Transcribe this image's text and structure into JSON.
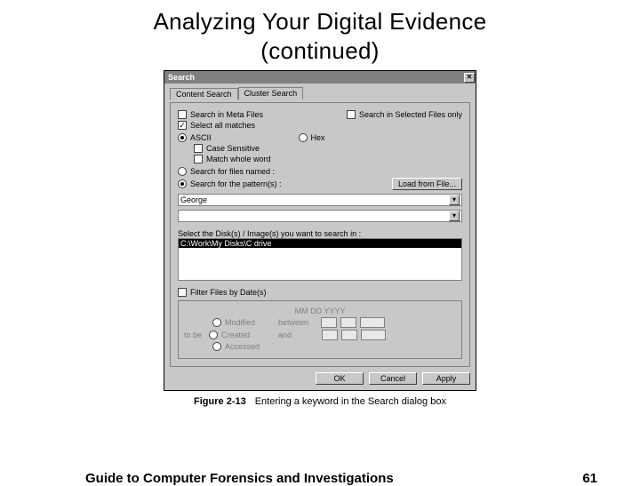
{
  "slide": {
    "title_l1": "Analyzing Your Digital Evidence",
    "title_l2": "(continued)"
  },
  "dialog": {
    "title": "Search",
    "tabs": {
      "content": "Content Search",
      "cluster": "Cluster Search"
    },
    "opts": {
      "search_meta": "Search in Meta Files",
      "search_selected": "Search in Selected Files only",
      "select_all": "Select all matches",
      "ascii": "ASCII",
      "hex": "Hex",
      "case_sensitive": "Case Sensitive",
      "whole_word": "Match whole word",
      "search_filenames": "Search for files named :",
      "search_patterns": "Search for the pattern(s) :",
      "load_btn": "Load from File...",
      "pattern_value": "George",
      "select_disks": "Select the Disk(s) / Image(s) you want to search in :",
      "disk_item": "C:\\Work\\My Disks\\C drive",
      "filter_dates": "Filter Files by Date(s)",
      "date_hdr": "MM   DD  YYYY",
      "modified": "Modified",
      "between": "between",
      "mlabel": "to be",
      "created": "Created",
      "and": "and",
      "accessed": "Accessed",
      "ok": "OK",
      "cancel": "Cancel",
      "apply": "Apply"
    }
  },
  "caption": {
    "figno": "Figure 2-13",
    "text": "Entering a keyword in the Search dialog box"
  },
  "footer": {
    "book": "Guide to Computer Forensics and Investigations",
    "page": "61"
  }
}
